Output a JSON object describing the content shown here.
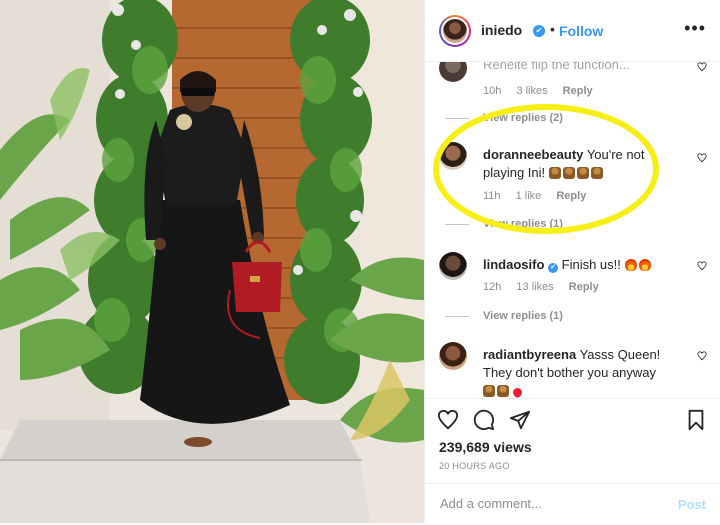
{
  "header": {
    "username": "iniedo",
    "dot": "•",
    "follow_label": "Follow",
    "more_label": "•••"
  },
  "comments": [
    {
      "username": "",
      "text": "Rehelte flip the function...",
      "time": "10h",
      "likes": "3 likes",
      "reply": "Reply",
      "view_replies": "View replies (2)"
    },
    {
      "username": "doranneebeauty",
      "text": "You're not playing Ini!",
      "emojis": [
        "e-hands",
        "e-hands",
        "e-hands",
        "e-hands"
      ],
      "time": "11h",
      "likes": "1 like",
      "reply": "Reply",
      "view_replies": "View replies (1)"
    },
    {
      "username": "lindaosifo",
      "text": "Finish us!!",
      "emojis": [
        "e-fire",
        "e-fire"
      ],
      "time": "12h",
      "likes": "13 likes",
      "reply": "Reply",
      "view_replies": "View replies (1)"
    },
    {
      "username": "radiantbyreena",
      "text": "Yasss Queen! They don't bother you anyway",
      "emojis": [
        "e-hands",
        "e-hands",
        "e-heart"
      ],
      "time": "",
      "likes": "",
      "reply": ""
    }
  ],
  "stats": {
    "views": "239,689 views",
    "ago": "20 HOURS AGO"
  },
  "add_comment": {
    "placeholder": "Add a comment...",
    "post_label": "Post"
  },
  "colors": {
    "accent": "#3897f0",
    "highlight": "#f6ee14",
    "muted": "#8e8e8e"
  },
  "icons": [
    "heart-icon",
    "comment-icon",
    "share-icon",
    "bookmark-icon",
    "verified-icon",
    "more-icon"
  ]
}
